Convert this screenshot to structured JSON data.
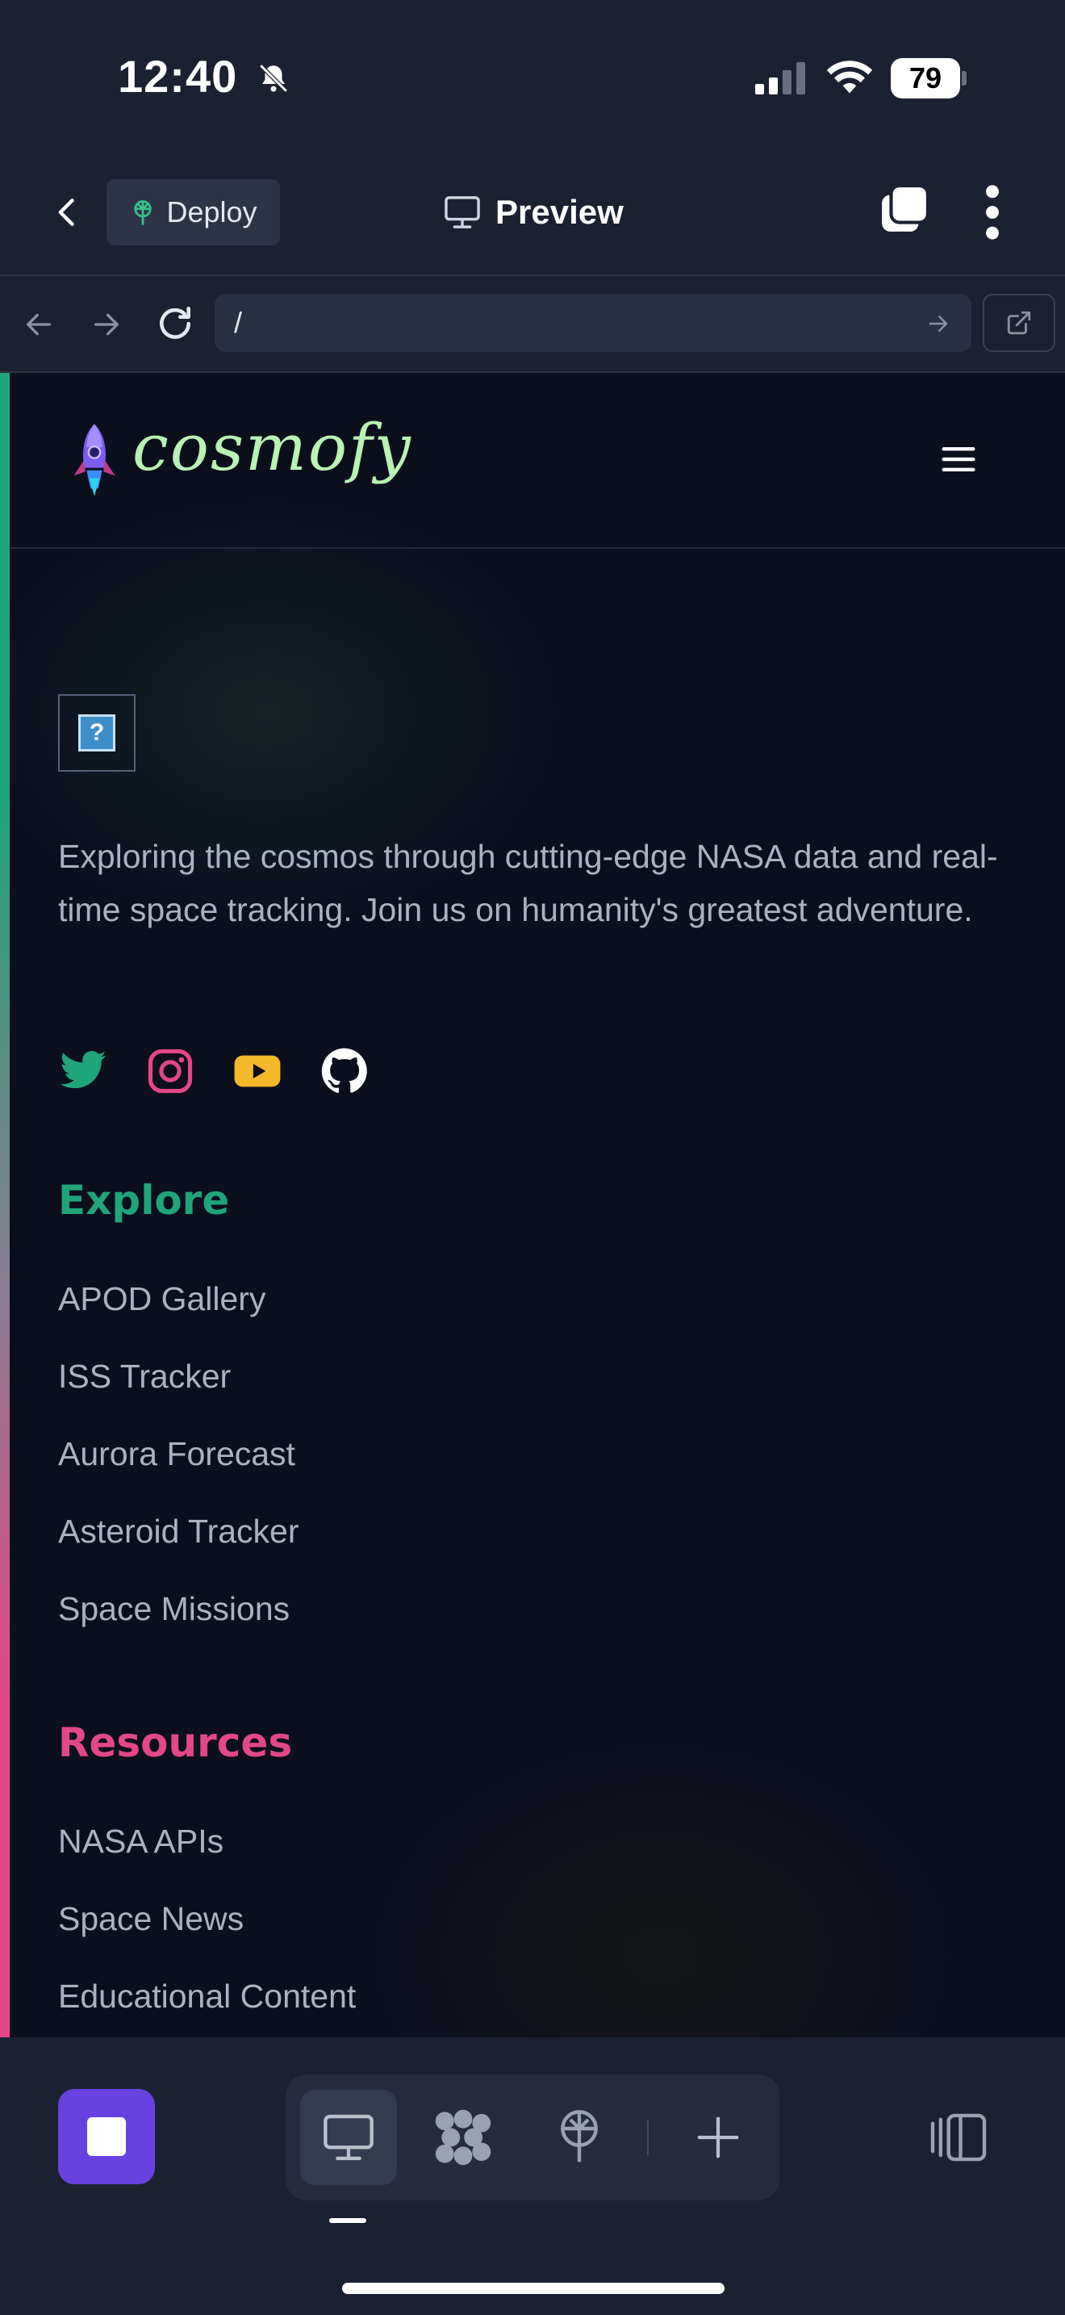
{
  "status_bar": {
    "time": "12:40",
    "battery": "79"
  },
  "toolbar": {
    "deploy_label": "Deploy",
    "preview_label": "Preview"
  },
  "browser": {
    "url": "/"
  },
  "site": {
    "logo_text": "cosmofy",
    "about": "Exploring the cosmos through cutting-edge NASA data and real-time space tracking. Join us on humanity's greatest adventure.",
    "social_icons": [
      "twitter-icon",
      "instagram-icon",
      "youtube-icon",
      "github-icon"
    ],
    "explore": {
      "title": "Explore",
      "links": [
        "APOD Gallery",
        "ISS Tracker",
        "Aurora Forecast",
        "Asteroid Tracker",
        "Space Missions"
      ]
    },
    "resources": {
      "title": "Resources",
      "links": [
        "NASA APIs",
        "Space News",
        "Educational Content"
      ]
    }
  },
  "colors": {
    "background": "#0b0f1c",
    "chrome": "#1c2131",
    "explore_accent": "#1ea57a",
    "resources_accent": "#e34786",
    "stop_button": "#6742e0"
  }
}
